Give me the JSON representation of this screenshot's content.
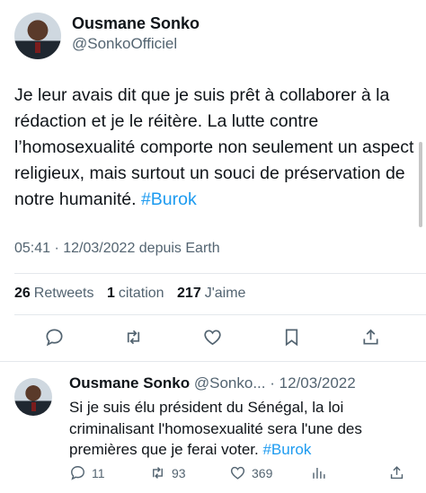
{
  "main_tweet": {
    "author_name": "Ousmane Sonko",
    "author_handle": "@SonkoOfficiel",
    "text_before_hashtag": "Je leur avais dit que je suis prêt à collaborer à la rédaction et je le réitère. La lutte contre l’homosexualité comporte non seulement un aspect religieux, mais surtout un souci de préservation de notre humanité.",
    "hashtag": "#Burok",
    "timestamp": "05:41 · 12/03/2022 depuis Earth",
    "stats": {
      "retweets_count": "26",
      "retweets_label": "Retweets",
      "quotes_count": "1",
      "quotes_label": "citation",
      "likes_count": "217",
      "likes_label": "J'aime"
    },
    "actions": [
      "reply-icon",
      "retweet-icon",
      "like-icon",
      "bookmark-icon",
      "share-icon"
    ]
  },
  "reply_tweet": {
    "author_name": "Ousmane Sonko",
    "meta": "@Sonko... · 12/03/2022",
    "text_before_hashtag": "Si je suis élu président du Sénégal, la loi criminalisant l'homosexualité sera l'une des premières que je ferai voter.",
    "hashtag": "#Burok",
    "actions": {
      "replies": "11",
      "retweets": "93",
      "likes": "369"
    }
  },
  "colors": {
    "text_primary": "#0f1419",
    "text_secondary": "#536471",
    "link": "#1d9bf0",
    "divider": "#e4e8ec"
  }
}
